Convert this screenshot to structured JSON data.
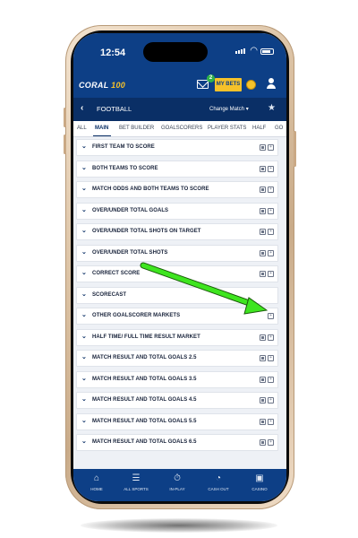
{
  "status": {
    "time": "12:54"
  },
  "brand": {
    "logo_main": "CORAL",
    "logo_accent": "100",
    "mail_badge": "2",
    "my_bets": "MY BETS"
  },
  "sport_bar": {
    "back": "‹",
    "title": "FOOTBALL",
    "change_match": "Change Match ▾"
  },
  "tabs": [
    {
      "label": "ALL"
    },
    {
      "label": "MAIN"
    },
    {
      "label": "BET BUILDER"
    },
    {
      "label": "GOALSCORERS"
    },
    {
      "label": "PLAYER STATS"
    },
    {
      "label": "HALF"
    },
    {
      "label": "GO"
    }
  ],
  "markets": [
    {
      "label": "FIRST TEAM TO SCORE",
      "icons": "both"
    },
    {
      "label": "BOTH TEAMS TO SCORE",
      "icons": "both"
    },
    {
      "label": "MATCH ODDS AND BOTH TEAMS TO SCORE",
      "icons": "both"
    },
    {
      "label": "OVER/UNDER TOTAL GOALS",
      "icons": "both"
    },
    {
      "label": "OVER/UNDER TOTAL SHOTS ON TARGET",
      "icons": "both"
    },
    {
      "label": "OVER/UNDER TOTAL SHOTS",
      "icons": "both"
    },
    {
      "label": "CORRECT SCORE",
      "icons": "both"
    },
    {
      "label": "SCORECAST",
      "icons": "none"
    },
    {
      "label": "OTHER GOALSCORER MARKETS",
      "icons": "single"
    },
    {
      "label": "HALF TIME/ FULL TIME RESULT MARKET",
      "icons": "both"
    },
    {
      "label": "MATCH RESULT AND TOTAL GOALS 2.5",
      "icons": "both"
    },
    {
      "label": "MATCH RESULT AND TOTAL GOALS 3.5",
      "icons": "both"
    },
    {
      "label": "MATCH RESULT AND TOTAL GOALS 4.5",
      "icons": "both"
    },
    {
      "label": "MATCH RESULT AND TOTAL GOALS 5.5",
      "icons": "both"
    },
    {
      "label": "MATCH RESULT AND TOTAL GOALS 6.5",
      "icons": "both"
    }
  ],
  "bottom_nav": [
    {
      "label": "HOME",
      "icon": "home-icon"
    },
    {
      "label": "ALL SPORTS",
      "icon": "menu-icon"
    },
    {
      "label": "IN-PLAY",
      "icon": "stopwatch-icon"
    },
    {
      "label": "CASH OUT",
      "icon": "cashout-icon"
    },
    {
      "label": "CASINO",
      "icon": "casino-icon"
    }
  ],
  "colors": {
    "brand_blue": "#0d3f86",
    "dark_blue": "#0a2f66",
    "gold": "#f6c22a",
    "arrow_green": "#34e01c"
  }
}
